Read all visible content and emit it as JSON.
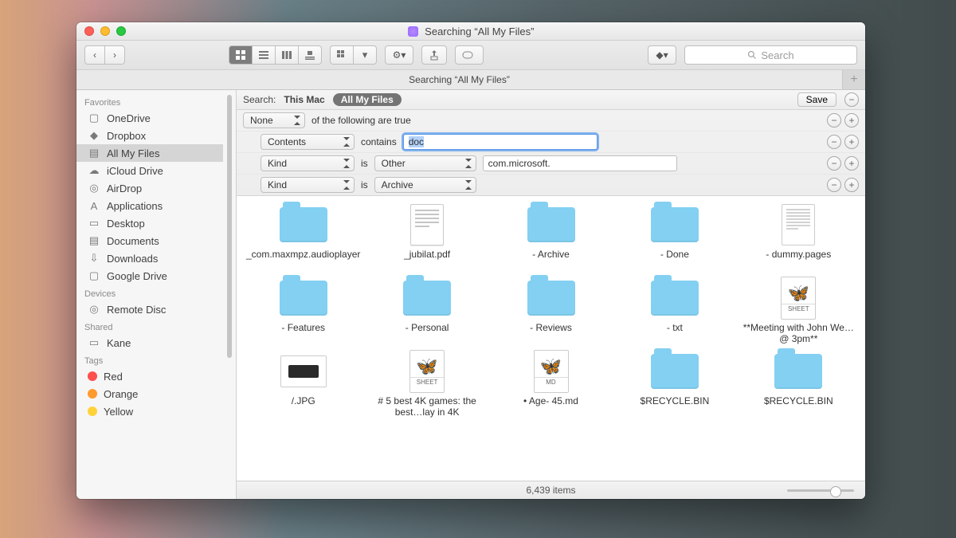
{
  "titlebar": {
    "title": "Searching “All My Files”"
  },
  "toolbar": {
    "search_placeholder": "Search"
  },
  "tabbar": {
    "tab1": "Searching “All My Files”",
    "plus": "+"
  },
  "sidebar": {
    "favorites_title": "Favorites",
    "devices_title": "Devices",
    "shared_title": "Shared",
    "tags_title": "Tags",
    "favorites": {
      "0": "OneDrive",
      "1": "Dropbox",
      "2": "All My Files",
      "3": "iCloud Drive",
      "4": "AirDrop",
      "5": "Applications",
      "6": "Desktop",
      "7": "Documents",
      "8": "Downloads",
      "9": "Google Drive"
    },
    "devices": {
      "0": "Remote Disc"
    },
    "shared": {
      "0": "Kane"
    },
    "tags": {
      "0": "Red",
      "1": "Orange",
      "2": "Yellow"
    }
  },
  "searchheader": {
    "label": "Search:",
    "scope_thismac": "This Mac",
    "scope_all": "All My Files",
    "save": "Save"
  },
  "criteria": {
    "row0": {
      "pop1": "None",
      "text": "of the following are true"
    },
    "row1": {
      "pop1": "Contents",
      "verb": "contains",
      "value": "doc"
    },
    "row2": {
      "pop1": "Kind",
      "verb": "is",
      "pop2": "Other",
      "value": "com.microsoft."
    },
    "row3": {
      "pop1": "Kind",
      "verb": "is",
      "pop2": "Archive"
    }
  },
  "files": {
    "0": {
      "label": "_com.maxmpz.audioplayer",
      "type": "folder"
    },
    "1": {
      "label": "_jubilat.pdf",
      "type": "textdoc"
    },
    "2": {
      "label": "- Archive",
      "type": "folder"
    },
    "3": {
      "label": "- Done",
      "type": "folder"
    },
    "4": {
      "label": "- dummy.pages",
      "type": "pagesdoc"
    },
    "5": {
      "label": "- Features",
      "type": "folder"
    },
    "6": {
      "label": "- Personal",
      "type": "folder"
    },
    "7": {
      "label": "- Reviews",
      "type": "folder"
    },
    "8": {
      "label": "- txt",
      "type": "folder"
    },
    "9": {
      "label": "**Meeting with John We…@ 3pm**",
      "type": "appicon",
      "badge": "SHEET"
    },
    "10": {
      "label": "/.JPG",
      "type": "jpg"
    },
    "11": {
      "label": "# 5 best 4K games: the best…lay in 4K",
      "type": "appicon",
      "badge": "SHEET"
    },
    "12": {
      "label": "• Age- 45.md",
      "type": "appicon",
      "badge": "MD"
    },
    "13": {
      "label": "$RECYCLE.BIN",
      "type": "folder"
    },
    "14": {
      "label": "$RECYCLE.BIN",
      "type": "folder"
    }
  },
  "status": {
    "text": "6,439 items"
  },
  "colors": {
    "tag_red": "#ff4e4e",
    "tag_orange": "#ff9a2e",
    "tag_yellow": "#ffd23a"
  }
}
